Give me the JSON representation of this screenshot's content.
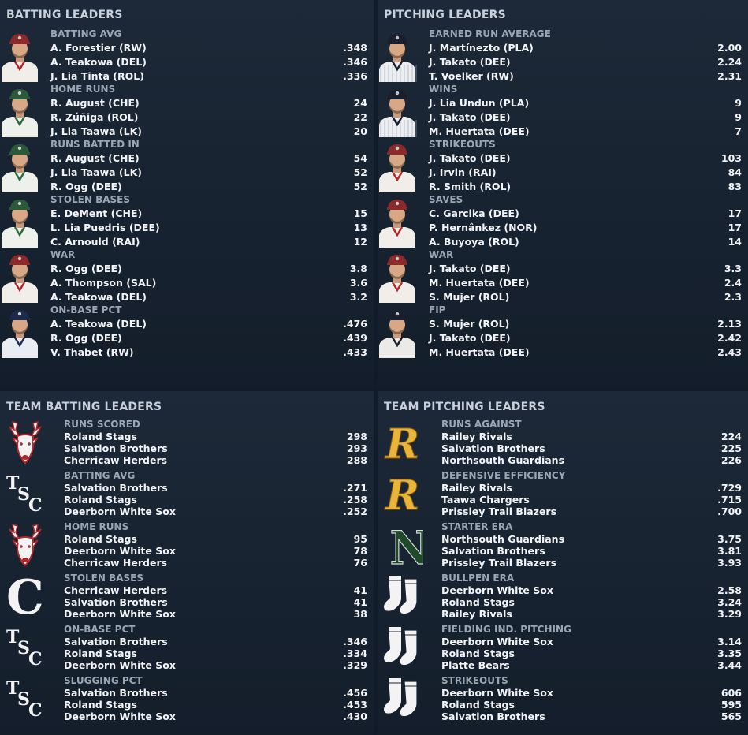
{
  "batting": {
    "title": "BATTING LEADERS",
    "categories": [
      {
        "label": "BATTING AVG",
        "cap": "#8a2a2a",
        "uniform": "red",
        "rows": [
          {
            "name": "A. Forestier (RW)",
            "value": ".348"
          },
          {
            "name": "A. Teakowa (DEL)",
            "value": ".346"
          },
          {
            "name": "J. Lia Tinta (ROL)",
            "value": ".336"
          }
        ]
      },
      {
        "label": "HOME RUNS",
        "cap": "#2a5a3a",
        "uniform": "green",
        "rows": [
          {
            "name": "R. August (CHE)",
            "value": "24"
          },
          {
            "name": "R. Zúñiga (ROL)",
            "value": "22"
          },
          {
            "name": "J. Lia Taawa (LK)",
            "value": "20"
          }
        ]
      },
      {
        "label": "RUNS BATTED IN",
        "cap": "#2a5a3a",
        "uniform": "green",
        "rows": [
          {
            "name": "R. August (CHE)",
            "value": "54"
          },
          {
            "name": "J. Lia Taawa (LK)",
            "value": "52"
          },
          {
            "name": "R. Ogg (DEE)",
            "value": "52"
          }
        ]
      },
      {
        "label": "STOLEN BASES",
        "cap": "#2a5a3a",
        "uniform": "green",
        "rows": [
          {
            "name": "E. DeMent (CHE)",
            "value": "15"
          },
          {
            "name": "L. Lia Puedris (DEE)",
            "value": "13"
          },
          {
            "name": "C. Arnould (RAI)",
            "value": "12"
          }
        ]
      },
      {
        "label": "WAR",
        "cap": "#8a2a2a",
        "uniform": "red",
        "rows": [
          {
            "name": "R. Ogg (DEE)",
            "value": "3.8"
          },
          {
            "name": "A. Thompson (SAL)",
            "value": "3.6"
          },
          {
            "name": "A. Teakowa (DEL)",
            "value": "3.2"
          }
        ]
      },
      {
        "label": "ON-BASE PCT",
        "cap": "#1d2a4a",
        "uniform": "navy",
        "rows": [
          {
            "name": "A. Teakowa (DEL)",
            "value": ".476"
          },
          {
            "name": "R. Ogg (DEE)",
            "value": ".439"
          },
          {
            "name": "V. Thabet (RW)",
            "value": ".433"
          }
        ]
      }
    ]
  },
  "pitching": {
    "title": "PITCHING LEADERS",
    "categories": [
      {
        "label": "EARNED RUN AVERAGE",
        "cap": "#1a1f2e",
        "uniform": "pinstripe",
        "rows": [
          {
            "name": "J. Martínezto (PLA)",
            "value": "2.00"
          },
          {
            "name": "J. Takato (DEE)",
            "value": "2.24"
          },
          {
            "name": "T. Voelker (RW)",
            "value": "2.31"
          }
        ]
      },
      {
        "label": "WINS",
        "cap": "#1a1f2e",
        "uniform": "pinstripe",
        "rows": [
          {
            "name": "J. Lia Undun (PLA)",
            "value": "9"
          },
          {
            "name": "J. Takato (DEE)",
            "value": "9"
          },
          {
            "name": "M. Huertata (DEE)",
            "value": "7"
          }
        ]
      },
      {
        "label": "STRIKEOUTS",
        "cap": "#8a2a2a",
        "uniform": "red",
        "rows": [
          {
            "name": "J. Takato (DEE)",
            "value": "103"
          },
          {
            "name": "J. Irvin (RAI)",
            "value": "84"
          },
          {
            "name": "R. Smith (ROL)",
            "value": "83"
          }
        ]
      },
      {
        "label": "SAVES",
        "cap": "#8a2a2a",
        "uniform": "red",
        "rows": [
          {
            "name": "C. Garcika (DEE)",
            "value": "17"
          },
          {
            "name": "P. Hernânkez (NOR)",
            "value": "17"
          },
          {
            "name": "A. Buyoya (ROL)",
            "value": "14"
          }
        ]
      },
      {
        "label": "WAR",
        "cap": "#8a2a2a",
        "uniform": "red",
        "rows": [
          {
            "name": "J. Takato (DEE)",
            "value": "3.3"
          },
          {
            "name": "M. Huertata (DEE)",
            "value": "2.4"
          },
          {
            "name": "S. Mujer (ROL)",
            "value": "2.3"
          }
        ]
      },
      {
        "label": "FIP",
        "cap": "#1a1f2e",
        "uniform": "white",
        "rows": [
          {
            "name": "S. Mujer (ROL)",
            "value": "2.13"
          },
          {
            "name": "J. Takato (DEE)",
            "value": "2.42"
          },
          {
            "name": "M. Huertata (DEE)",
            "value": "2.43"
          }
        ]
      }
    ]
  },
  "team_batting": {
    "title": "TEAM BATTING LEADERS",
    "categories": [
      {
        "label": "RUNS SCORED",
        "logo": "stag-head-icon",
        "rows": [
          {
            "name": "Roland Stags",
            "value": "298"
          },
          {
            "name": "Salvation Brothers",
            "value": "293"
          },
          {
            "name": "Cherricaw Herders",
            "value": "288"
          }
        ]
      },
      {
        "label": "BATTING AVG",
        "logo": "tsc-monogram-icon",
        "rows": [
          {
            "name": "Salvation Brothers",
            "value": ".271"
          },
          {
            "name": "Roland Stags",
            "value": ".258"
          },
          {
            "name": "Deerborn White Sox",
            "value": ".252"
          }
        ]
      },
      {
        "label": "HOME RUNS",
        "logo": "stag-head-icon",
        "rows": [
          {
            "name": "Roland Stags",
            "value": "95"
          },
          {
            "name": "Deerborn White Sox",
            "value": "78"
          },
          {
            "name": "Cherricaw Herders",
            "value": "76"
          }
        ]
      },
      {
        "label": "STOLEN BASES",
        "logo": "old-english-c-icon",
        "rows": [
          {
            "name": "Cherricaw Herders",
            "value": "41"
          },
          {
            "name": "Salvation Brothers",
            "value": "41"
          },
          {
            "name": "Deerborn White Sox",
            "value": "38"
          }
        ]
      },
      {
        "label": "ON-BASE PCT",
        "logo": "tsc-monogram-icon",
        "rows": [
          {
            "name": "Salvation Brothers",
            "value": ".346"
          },
          {
            "name": "Roland Stags",
            "value": ".334"
          },
          {
            "name": "Deerborn White Sox",
            "value": ".329"
          }
        ]
      },
      {
        "label": "SLUGGING PCT",
        "logo": "tsc-monogram-icon",
        "rows": [
          {
            "name": "Salvation Brothers",
            "value": ".456"
          },
          {
            "name": "Roland Stags",
            "value": ".453"
          },
          {
            "name": "Deerborn White Sox",
            "value": ".430"
          }
        ]
      }
    ]
  },
  "team_pitching": {
    "title": "TEAM PITCHING LEADERS",
    "categories": [
      {
        "label": "RUNS AGAINST",
        "logo": "script-r-icon",
        "rows": [
          {
            "name": "Railey Rivals",
            "value": "224"
          },
          {
            "name": "Salvation Brothers",
            "value": "225"
          },
          {
            "name": "Northsouth Guardians",
            "value": "226"
          }
        ]
      },
      {
        "label": "DEFENSIVE EFFICIENCY",
        "logo": "script-r-icon",
        "rows": [
          {
            "name": "Railey Rivals",
            "value": ".729"
          },
          {
            "name": "Taawa Chargers",
            "value": ".715"
          },
          {
            "name": "Prissley Trail Blazers",
            "value": ".700"
          }
        ]
      },
      {
        "label": "STARTER ERA",
        "logo": "letter-n-icon",
        "rows": [
          {
            "name": "Northsouth Guardians",
            "value": "3.75"
          },
          {
            "name": "Salvation Brothers",
            "value": "3.81"
          },
          {
            "name": "Prissley Trail Blazers",
            "value": "3.93"
          }
        ]
      },
      {
        "label": "BULLPEN ERA",
        "logo": "socks-icon",
        "rows": [
          {
            "name": "Deerborn White Sox",
            "value": "2.58"
          },
          {
            "name": "Roland Stags",
            "value": "3.24"
          },
          {
            "name": "Railey Rivals",
            "value": "3.29"
          }
        ]
      },
      {
        "label": "FIELDING IND. PITCHING",
        "logo": "socks-icon",
        "rows": [
          {
            "name": "Deerborn White Sox",
            "value": "3.14"
          },
          {
            "name": "Roland Stags",
            "value": "3.35"
          },
          {
            "name": "Platte Bears",
            "value": "3.44"
          }
        ]
      },
      {
        "label": "STRIKEOUTS",
        "logo": "socks-icon",
        "rows": [
          {
            "name": "Deerborn White Sox",
            "value": "606"
          },
          {
            "name": "Roland Stags",
            "value": "595"
          },
          {
            "name": "Salvation Brothers",
            "value": "565"
          }
        ]
      }
    ]
  }
}
